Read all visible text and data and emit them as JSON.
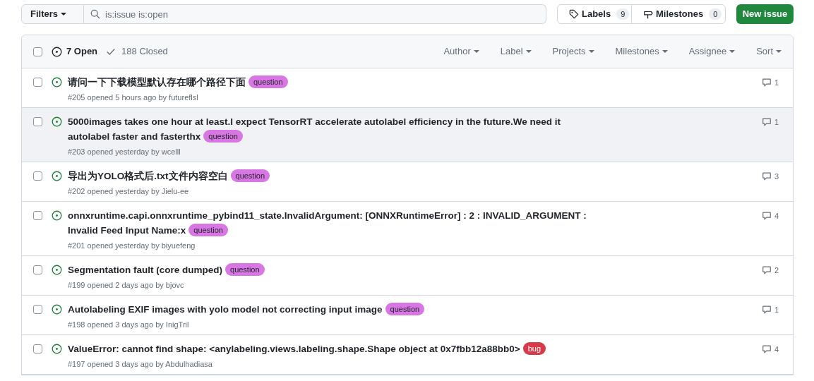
{
  "toolbar": {
    "filters": "Filters",
    "search": {
      "value": "is:issue is:open"
    },
    "labels": {
      "text": "Labels",
      "count": "9"
    },
    "milestones": {
      "text": "Milestones",
      "count": "0"
    },
    "new_issue": "New issue"
  },
  "header": {
    "checked": false,
    "open": {
      "text": "7 Open",
      "selected": true
    },
    "closed": {
      "text": "188 Closed",
      "selected": false
    },
    "filters": [
      "Author",
      "Label",
      "Projects",
      "Milestones",
      "Assignee",
      "Sort"
    ]
  },
  "issues": [
    {
      "title": "请问一下下载模型默认存在哪个路径下面",
      "labels": [
        {
          "name": "question",
          "color": "#d876e3"
        }
      ],
      "meta": "#205 opened 5 hours ago by futureflsl",
      "comments": "1",
      "checked": false,
      "hovered": false
    },
    {
      "title": "5000images takes one hour at least.I expect TensorRT accelerate autolabel efficiency in the future.We need it autolabel faster and fasterthx",
      "labels": [
        {
          "name": "question",
          "color": "#d876e3"
        }
      ],
      "meta": "#203 opened yesterday by wcelll",
      "comments": "1",
      "checked": false,
      "hovered": true
    },
    {
      "title": "导出为YOLO格式后.txt文件内容空白",
      "labels": [
        {
          "name": "question",
          "color": "#d876e3"
        }
      ],
      "meta": "#202 opened yesterday by Jielu-ee",
      "comments": "3",
      "checked": false,
      "hovered": false
    },
    {
      "title": "onnxruntime.capi.onnxruntime_pybind11_state.InvalidArgument: [ONNXRuntimeError] : 2 : INVALID_ARGUMENT : Invalid Feed Input Name:x",
      "labels": [
        {
          "name": "question",
          "color": "#d876e3"
        }
      ],
      "meta": "#201 opened yesterday by biyuefeng",
      "comments": "4",
      "checked": false,
      "hovered": false
    },
    {
      "title": "Segmentation fault (core dumped)",
      "labels": [
        {
          "name": "question",
          "color": "#d876e3"
        }
      ],
      "meta": "#199 opened 2 days ago by bjovc",
      "comments": "2",
      "checked": false,
      "hovered": false
    },
    {
      "title": "Autolabeling EXIF images with yolo model not correcting input image",
      "labels": [
        {
          "name": "question",
          "color": "#d876e3"
        }
      ],
      "meta": "#198 opened 3 days ago by InigTril",
      "comments": "1",
      "checked": false,
      "hovered": false
    },
    {
      "title": "ValueError: cannot find shape: <anylabeling.views.labeling.shape.Shape object at 0x7fbb12a88bb0>",
      "labels": [
        {
          "name": "bug",
          "color": "#d73a4a"
        }
      ],
      "meta": "#197 opened 3 days ago by Abdulhadiasa",
      "comments": "4",
      "checked": false,
      "hovered": false
    }
  ]
}
